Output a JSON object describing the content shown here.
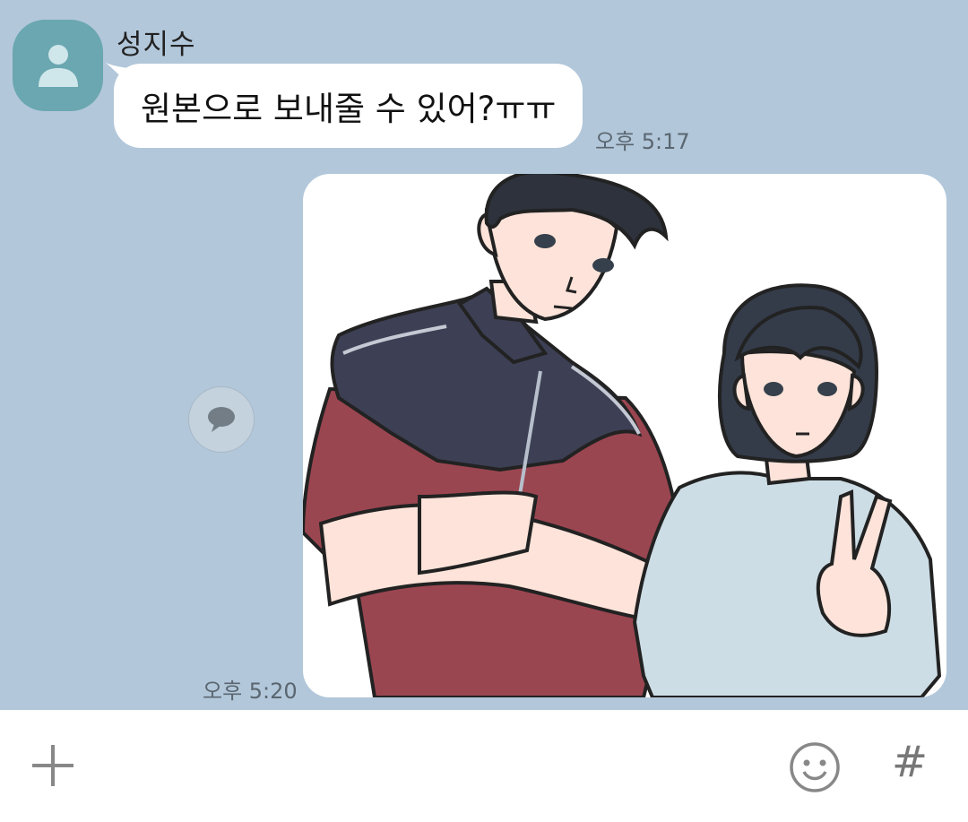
{
  "chat": {
    "incoming": {
      "sender_name": "성지수",
      "avatar_icon": "person-icon",
      "text": "원본으로 보내줄 수 있어?ㅠㅠ",
      "time": "오후 5:17"
    },
    "outgoing": {
      "type": "image",
      "time": "오후 5:20",
      "share_icon": "speech-bubble-icon"
    }
  },
  "input_bar": {
    "plus_icon": "plus-icon",
    "emoji_icon": "emoji-icon",
    "hash_label": "#"
  },
  "colors": {
    "background": "#b2c7da",
    "avatar": "#6aa7b0",
    "bubble": "#ffffff"
  }
}
